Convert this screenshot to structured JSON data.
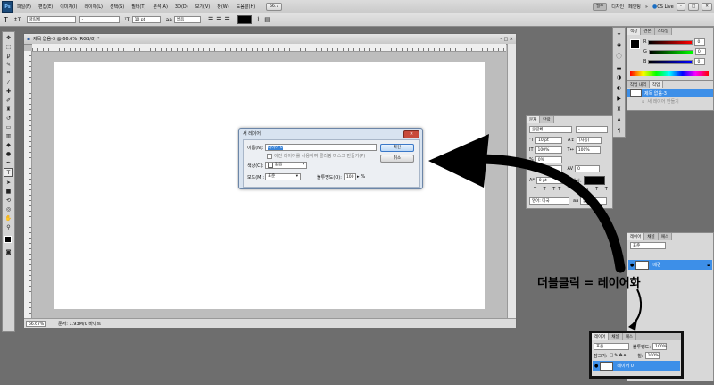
{
  "menubar": {
    "logo": "Ps",
    "items": [
      "파일(F)",
      "편집(E)",
      "이미지(I)",
      "레이어(L)",
      "선택(S)",
      "필터(T)",
      "분석(A)",
      "3D(D)",
      "보기(V)",
      "창(W)",
      "도움말(H)"
    ],
    "zoom": "66.7",
    "right": {
      "workspace": "필수",
      "design": "디자인",
      "paint": "페인팅",
      "more": "»",
      "cslive": "CS Live"
    }
  },
  "optionsbar": {
    "font_family": "굴림체",
    "font_style": "-",
    "font_size": "10 pt",
    "antialias": "없음",
    "color": "#000000"
  },
  "document": {
    "title": "제목 없음-3 @ 66.6% (RGB/8) *",
    "zoom_status": "66.67%",
    "doc_info": "문서: 1.93M/0 바이트"
  },
  "dialog": {
    "title": "새 레이어",
    "name_label": "이름(N):",
    "name_value": "레이어 0",
    "clip_label": "이전 레이어를 사용하여 클리핑 마스크 만들기(P)",
    "color_label": "색상(C):",
    "color_value": "없음",
    "mode_label": "모드(M):",
    "mode_value": "표준",
    "opacity_label": "불투명도(O):",
    "opacity_value": "100",
    "opacity_unit": "%",
    "ok": "확인",
    "cancel": "취소"
  },
  "color_panel": {
    "tabs": [
      "색상",
      "견본",
      "스타일"
    ],
    "values": [
      "0",
      "0",
      "0"
    ]
  },
  "history_panel": {
    "tabs": [
      "작업 내역",
      "작업"
    ],
    "items": [
      "제목 없음-3",
      "새 레이어 만들기"
    ]
  },
  "char_panel": {
    "tabs": [
      "문자",
      "단락"
    ],
    "font": "굴림체",
    "style": "-",
    "size": "10 pt",
    "leading": "(자동)",
    "scale_v": "100%",
    "scale_h": "100%",
    "tracking": "0%",
    "kerning": "0",
    "baseline": "0 pt",
    "color_label": "색상:",
    "lang": "영어: 미국",
    "aa": "없음"
  },
  "layers_panel": {
    "tabs": [
      "레이어",
      "채널",
      "패스"
    ],
    "mode": "표준",
    "layer_name": "배경"
  },
  "annotation": {
    "text": "더블클릭 = 레이어화"
  },
  "callout_panel": {
    "tabs": [
      "레이어",
      "채널",
      "패스"
    ],
    "mode": "표준",
    "opacity_label": "불투명도:",
    "opacity_value": "100%",
    "lock_label": "잠그기:",
    "fill_label": "칠:",
    "fill_value": "100%",
    "layer_name": "레이어 0"
  }
}
